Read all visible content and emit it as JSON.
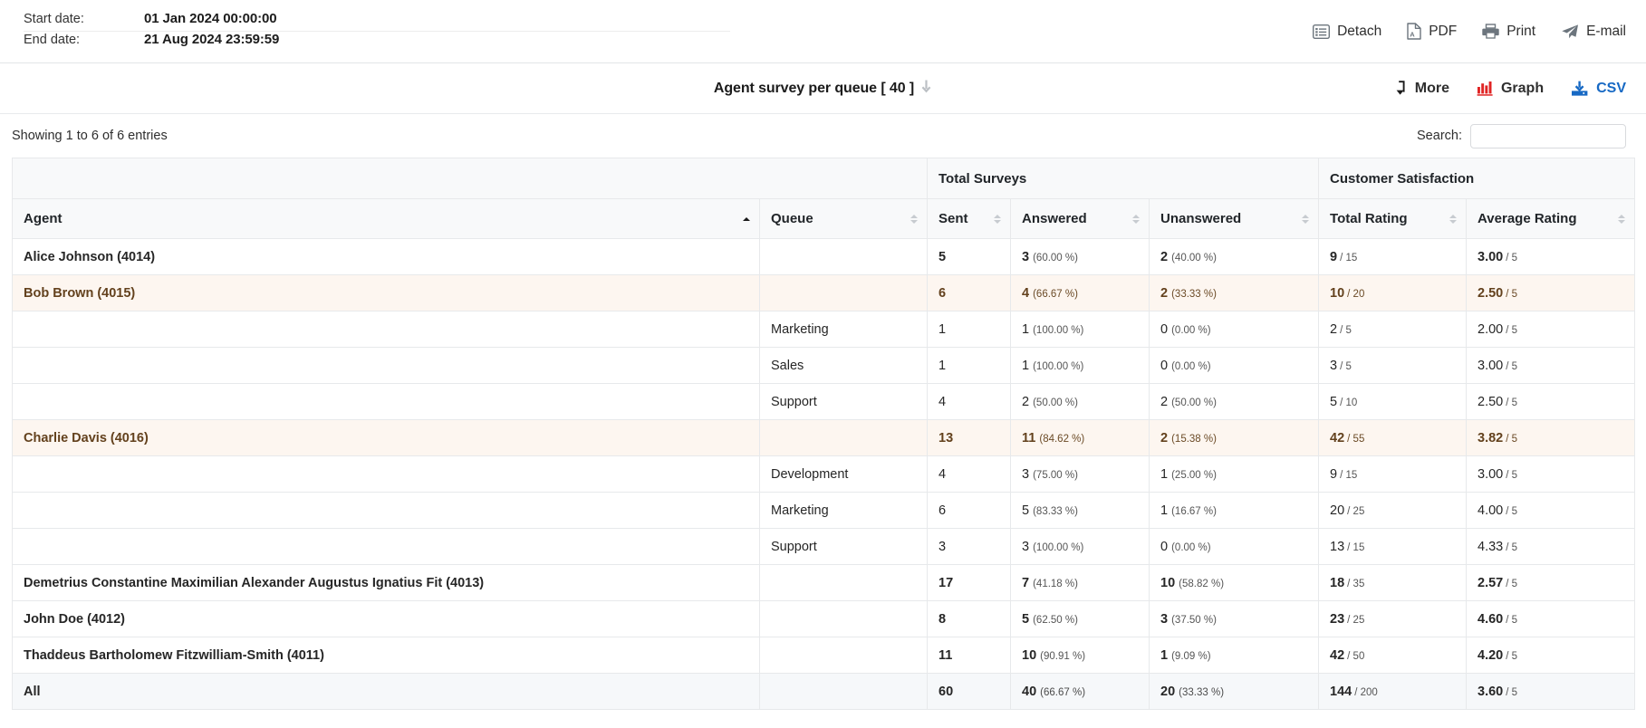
{
  "header": {
    "start_label": "Start date:",
    "start_value": "01 Jan 2024 00:00:00",
    "end_label": "End date:",
    "end_value": "21 Aug 2024 23:59:59",
    "actions": [
      {
        "label": "Detach",
        "icon": "detach-icon"
      },
      {
        "label": "PDF",
        "icon": "pdf-icon"
      },
      {
        "label": "Print",
        "icon": "print-icon"
      },
      {
        "label": "E-mail",
        "icon": "email-icon"
      }
    ]
  },
  "title_bar": {
    "title": "Agent survey per queue [ 40 ]",
    "collapse_icon": "arrow-down-icon",
    "actions": [
      {
        "label": "More",
        "icon": "more-arrow-icon"
      },
      {
        "label": "Graph",
        "icon": "bar-chart-icon"
      },
      {
        "label": "CSV",
        "icon": "download-icon"
      }
    ]
  },
  "info_bar": {
    "showing": "Showing 1 to 6 of 6 entries",
    "search_label": "Search:",
    "search_value": "",
    "search_placeholder": ""
  },
  "table": {
    "group_headers": [
      {
        "label": "",
        "span": 2
      },
      {
        "label": "Total Surveys",
        "span": 3
      },
      {
        "label": "Customer Satisfaction",
        "span": 2
      }
    ],
    "columns": [
      {
        "label": "Agent",
        "sort": "asc"
      },
      {
        "label": "Queue",
        "sort": "none"
      },
      {
        "label": "Sent",
        "sort": "none"
      },
      {
        "label": "Answered",
        "sort": "none"
      },
      {
        "label": "Unanswered",
        "sort": "none"
      },
      {
        "label": "Total Rating",
        "sort": "none"
      },
      {
        "label": "Average Rating",
        "sort": "none"
      }
    ],
    "rows": [
      {
        "type": "agent",
        "highlight": false,
        "agent": "Alice Johnson (4014)",
        "queue": "",
        "sent": "5",
        "answered": "3",
        "answered_pct": "(60.00 %)",
        "unanswered": "2",
        "unanswered_pct": "(40.00 %)",
        "total_rating": "9",
        "total_rating_max": "/ 15",
        "avg_rating": "3.00",
        "avg_rating_max": "/ 5"
      },
      {
        "type": "agent",
        "highlight": true,
        "agent": "Bob Brown (4015)",
        "queue": "",
        "sent": "6",
        "answered": "4",
        "answered_pct": "(66.67 %)",
        "unanswered": "2",
        "unanswered_pct": "(33.33 %)",
        "total_rating": "10",
        "total_rating_max": "/ 20",
        "avg_rating": "2.50",
        "avg_rating_max": "/ 5"
      },
      {
        "type": "queue",
        "highlight": false,
        "agent": "",
        "queue": "Marketing",
        "sent": "1",
        "answered": "1",
        "answered_pct": "(100.00 %)",
        "unanswered": "0",
        "unanswered_pct": "(0.00 %)",
        "total_rating": "2",
        "total_rating_max": "/ 5",
        "avg_rating": "2.00",
        "avg_rating_max": "/ 5"
      },
      {
        "type": "queue",
        "highlight": false,
        "agent": "",
        "queue": "Sales",
        "sent": "1",
        "answered": "1",
        "answered_pct": "(100.00 %)",
        "unanswered": "0",
        "unanswered_pct": "(0.00 %)",
        "total_rating": "3",
        "total_rating_max": "/ 5",
        "avg_rating": "3.00",
        "avg_rating_max": "/ 5"
      },
      {
        "type": "queue",
        "highlight": false,
        "agent": "",
        "queue": "Support",
        "sent": "4",
        "answered": "2",
        "answered_pct": "(50.00 %)",
        "unanswered": "2",
        "unanswered_pct": "(50.00 %)",
        "total_rating": "5",
        "total_rating_max": "/ 10",
        "avg_rating": "2.50",
        "avg_rating_max": "/ 5"
      },
      {
        "type": "agent",
        "highlight": true,
        "agent": "Charlie Davis (4016)",
        "queue": "",
        "sent": "13",
        "answered": "11",
        "answered_pct": "(84.62 %)",
        "unanswered": "2",
        "unanswered_pct": "(15.38 %)",
        "total_rating": "42",
        "total_rating_max": "/ 55",
        "avg_rating": "3.82",
        "avg_rating_max": "/ 5"
      },
      {
        "type": "queue",
        "highlight": false,
        "agent": "",
        "queue": "Development",
        "sent": "4",
        "answered": "3",
        "answered_pct": "(75.00 %)",
        "unanswered": "1",
        "unanswered_pct": "(25.00 %)",
        "total_rating": "9",
        "total_rating_max": "/ 15",
        "avg_rating": "3.00",
        "avg_rating_max": "/ 5"
      },
      {
        "type": "queue",
        "highlight": false,
        "agent": "",
        "queue": "Marketing",
        "sent": "6",
        "answered": "5",
        "answered_pct": "(83.33 %)",
        "unanswered": "1",
        "unanswered_pct": "(16.67 %)",
        "total_rating": "20",
        "total_rating_max": "/ 25",
        "avg_rating": "4.00",
        "avg_rating_max": "/ 5"
      },
      {
        "type": "queue",
        "highlight": false,
        "agent": "",
        "queue": "Support",
        "sent": "3",
        "answered": "3",
        "answered_pct": "(100.00 %)",
        "unanswered": "0",
        "unanswered_pct": "(0.00 %)",
        "total_rating": "13",
        "total_rating_max": "/ 15",
        "avg_rating": "4.33",
        "avg_rating_max": "/ 5"
      },
      {
        "type": "agent",
        "highlight": false,
        "agent": "Demetrius Constantine Maximilian Alexander Augustus Ignatius Fit (4013)",
        "queue": "",
        "sent": "17",
        "answered": "7",
        "answered_pct": "(41.18 %)",
        "unanswered": "10",
        "unanswered_pct": "(58.82 %)",
        "total_rating": "18",
        "total_rating_max": "/ 35",
        "avg_rating": "2.57",
        "avg_rating_max": "/ 5"
      },
      {
        "type": "agent",
        "highlight": false,
        "agent": "John Doe (4012)",
        "queue": "",
        "sent": "8",
        "answered": "5",
        "answered_pct": "(62.50 %)",
        "unanswered": "3",
        "unanswered_pct": "(37.50 %)",
        "total_rating": "23",
        "total_rating_max": "/ 25",
        "avg_rating": "4.60",
        "avg_rating_max": "/ 5"
      },
      {
        "type": "agent",
        "highlight": false,
        "agent": "Thaddeus Bartholomew Fitzwilliam-Smith (4011)",
        "queue": "",
        "sent": "11",
        "answered": "10",
        "answered_pct": "(90.91 %)",
        "unanswered": "1",
        "unanswered_pct": "(9.09 %)",
        "total_rating": "42",
        "total_rating_max": "/ 50",
        "avg_rating": "4.20",
        "avg_rating_max": "/ 5"
      },
      {
        "type": "total",
        "highlight": false,
        "agent": "All",
        "queue": "",
        "sent": "60",
        "answered": "40",
        "answered_pct": "(66.67 %)",
        "unanswered": "20",
        "unanswered_pct": "(33.33 %)",
        "total_rating": "144",
        "total_rating_max": "/ 200",
        "avg_rating": "3.60",
        "avg_rating_max": "/ 5"
      }
    ]
  },
  "colors": {
    "highlight_bg": "#fdf6f0",
    "highlight_text": "#63411d",
    "total_bg": "#f6f8fa",
    "header_bg": "#f8f9fa",
    "csv_blue": "#1769c4",
    "graph_red": "#e02424"
  }
}
